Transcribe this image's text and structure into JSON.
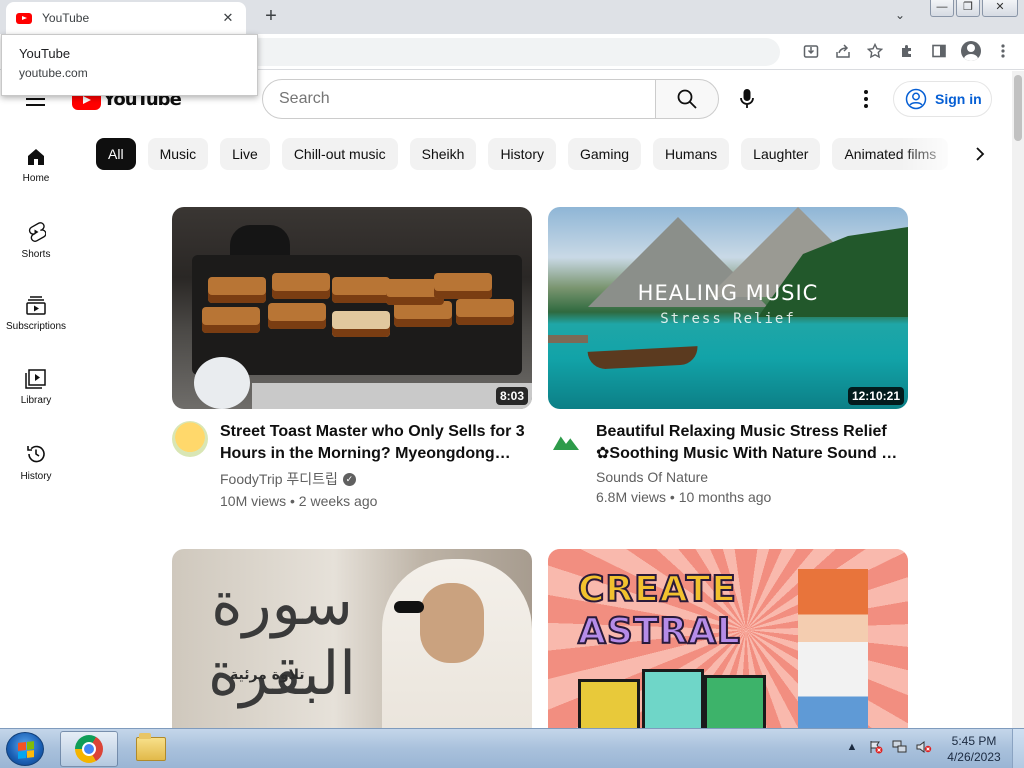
{
  "browser": {
    "tab_title": "YouTube",
    "tab_close_glyph": "✕",
    "new_tab_glyph": "+",
    "tab_search_glyph": "⌄",
    "window_buttons": [
      "—",
      "❐",
      "✕"
    ],
    "hovercard": {
      "title": "YouTube",
      "url": "youtube.com"
    },
    "toolbar_icons": [
      "install-icon",
      "share-icon",
      "bookmark-star-icon",
      "extensions-icon",
      "side-panel-icon",
      "profile-icon",
      "chrome-menu-icon"
    ]
  },
  "youtube": {
    "logo_text": "YouTube",
    "search_placeholder": "Search",
    "search_value": "",
    "sign_in_label": "Sign in",
    "guide": [
      {
        "label": "Home",
        "icon": "home-icon"
      },
      {
        "label": "Shorts",
        "icon": "shorts-icon"
      },
      {
        "label": "Subscriptions",
        "icon": "subscriptions-icon"
      },
      {
        "label": "Library",
        "icon": "library-icon"
      },
      {
        "label": "History",
        "icon": "history-icon"
      }
    ],
    "chips": [
      "All",
      "Music",
      "Live",
      "Chill-out music",
      "Sheikh",
      "History",
      "Gaming",
      "Humans",
      "Laughter",
      "Animated films"
    ],
    "active_chip": "All",
    "videos": [
      {
        "title": "Street Toast Master who Only Sells for 3 Hours in the Morning? Myeongdong…",
        "channel": "FoodyTrip 푸디트립",
        "verified": true,
        "stats": "10M views • 2 weeks ago",
        "duration": "8:03"
      },
      {
        "title": "Beautiful Relaxing Music Stress Relief ✿Soothing Music With Nature Sound …",
        "channel": "Sounds Of Nature",
        "verified": false,
        "stats": "6.8M views • 10 months ago",
        "duration": "12:10:21",
        "thumb_text_1": "HEALING MUSIC",
        "thumb_text_2": "Stress Relief"
      },
      {
        "thumb_calligraphy": "سورة البقرة",
        "thumb_subtitle": "تلاوة مرئية"
      },
      {
        "thumb_title_1": "CREATE",
        "thumb_title_2": "ASTRAL"
      }
    ]
  },
  "taskbar": {
    "apps": [
      "chrome-icon",
      "folder-icon"
    ],
    "clock_time": "5:45 PM",
    "clock_date": "4/26/2023",
    "tray_icons": [
      "show-hidden-icons-icon",
      "action-center-icon",
      "network-icon",
      "volume-muted-icon"
    ]
  },
  "colors": {
    "youtube_red": "#ff0000",
    "signin_blue": "#065fd4",
    "chip_active_bg": "#0f0f0f",
    "chip_bg": "#f2f2f2"
  }
}
